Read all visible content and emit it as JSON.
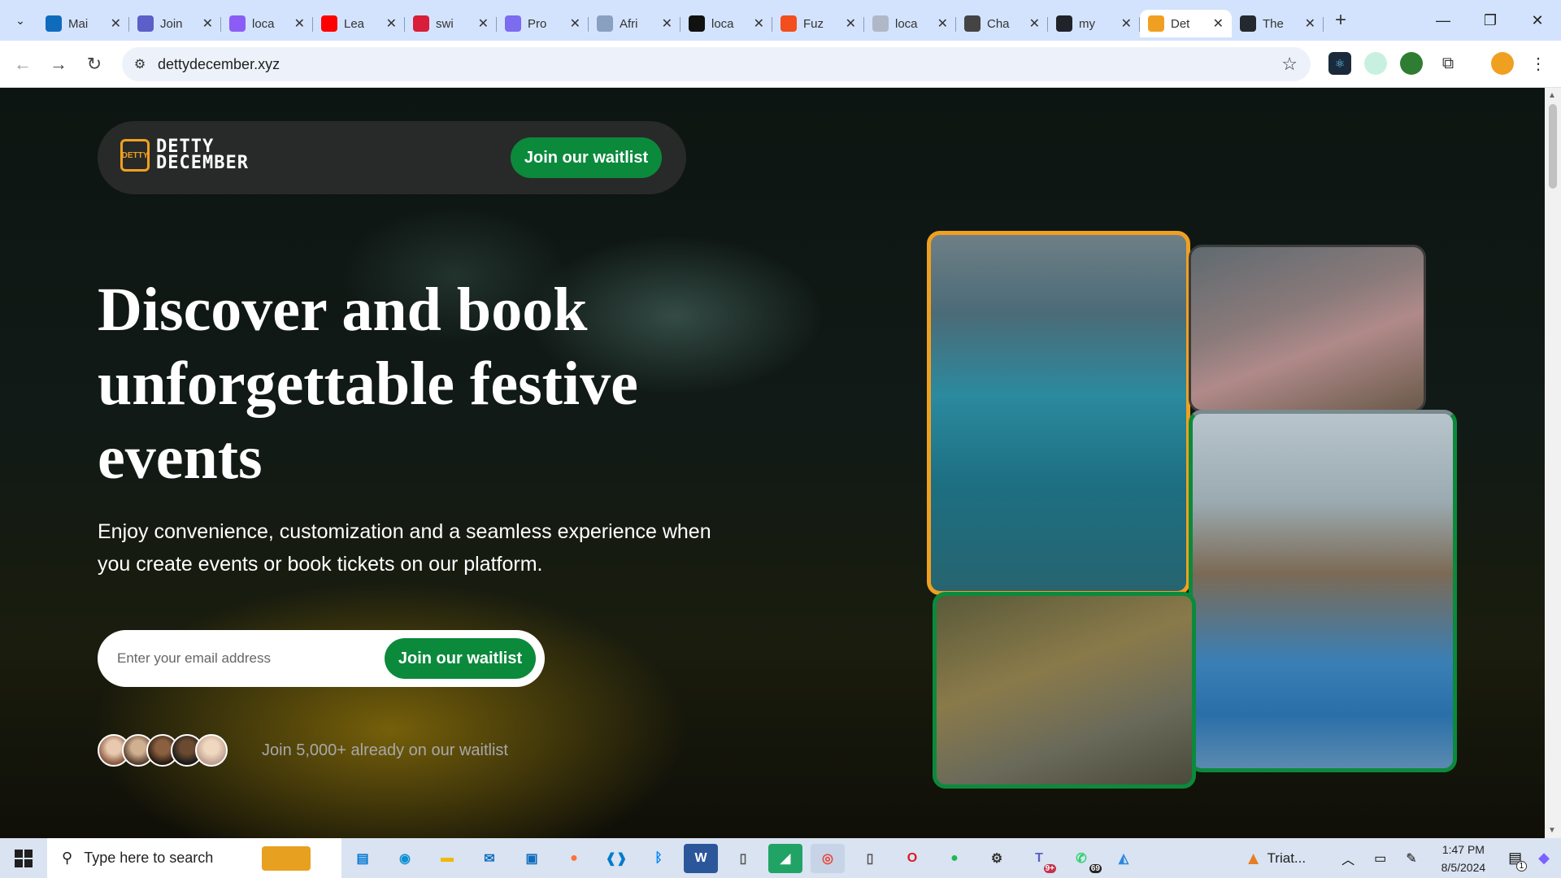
{
  "browser": {
    "tabs": [
      {
        "label": "Mai",
        "icon": "outlook-icon",
        "color": "#0f6cbd"
      },
      {
        "label": "Join",
        "icon": "teams-icon",
        "color": "#5b5fc7"
      },
      {
        "label": "loca",
        "icon": "square-icon",
        "color": "#8b5cf6"
      },
      {
        "label": "Lea",
        "icon": "youtube-icon",
        "color": "#ff0000"
      },
      {
        "label": "swi",
        "icon": "app-icon",
        "color": "#d91e3a"
      },
      {
        "label": "Pro",
        "icon": "app-icon",
        "color": "#7c6cf0"
      },
      {
        "label": "Afri",
        "icon": "globe-icon",
        "color": "#8aa0c0"
      },
      {
        "label": "loca",
        "icon": "triangle-icon",
        "color": "#111111"
      },
      {
        "label": "Fuz",
        "icon": "figma-icon",
        "color": "#f24e1e"
      },
      {
        "label": "loca",
        "icon": "globe-icon",
        "color": "#b0b8c8"
      },
      {
        "label": "Cha",
        "icon": "chatgpt-icon",
        "color": "#444444"
      },
      {
        "label": "my",
        "icon": "react-icon",
        "color": "#20232a"
      },
      {
        "label": "Det",
        "icon": "dettydecember-icon",
        "color": "#f0a020",
        "active": true
      },
      {
        "label": "The",
        "icon": "github-icon",
        "color": "#24292f"
      }
    ],
    "address": "dettydecember.xyz"
  },
  "site": {
    "nav_cta": "Join our waitlist",
    "logo_line1": "DETTY",
    "logo_line2": "DECEMBER",
    "logo_badge": "DETTY"
  },
  "hero": {
    "title": "Discover and book unforgettable festive events",
    "subtitle": "Enjoy convenience, customization and a seamless experience when you create events or book tickets on our platform.",
    "email_placeholder": "Enter your email address",
    "form_cta": "Join our waitlist",
    "social_proof": "Join 5,000+ already on our waitlist"
  },
  "colors": {
    "brand_green": "#0b8a3c",
    "brand_orange": "#f0a020"
  },
  "taskbar": {
    "search_placeholder": "Type here to search",
    "weather": "Triat...",
    "time": "1:47 PM",
    "date": "8/5/2024",
    "teams_badge": "9+",
    "whatsapp_badge": "69",
    "notification_badge": "1"
  }
}
